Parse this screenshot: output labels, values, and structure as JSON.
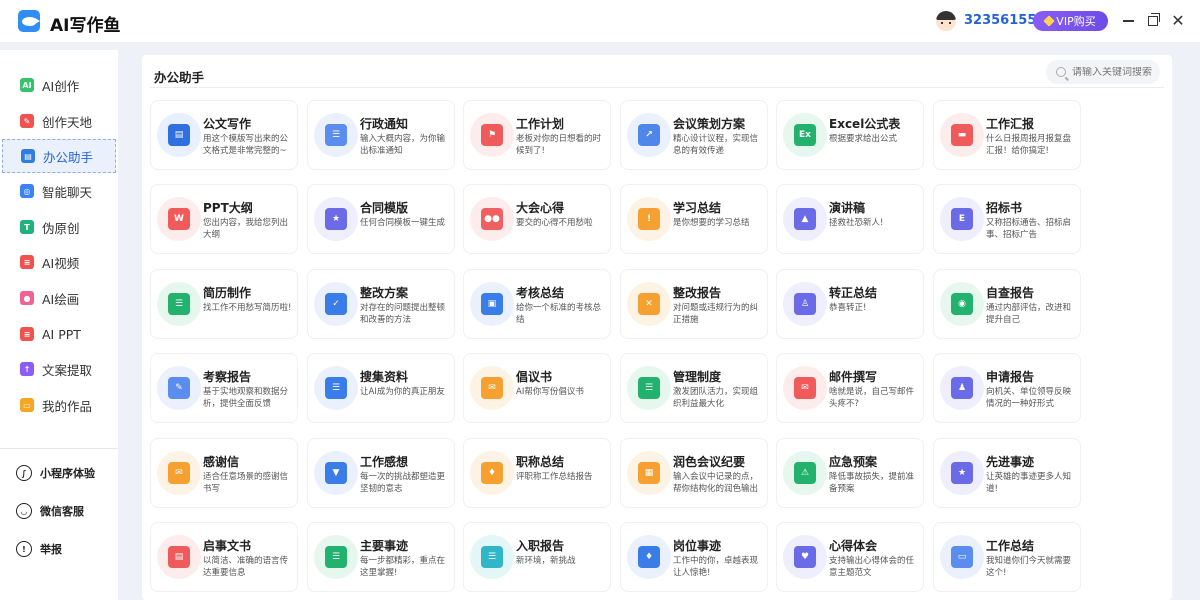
{
  "app": {
    "title": "AI写作鱼"
  },
  "header": {
    "user_id": "32356155",
    "vip_label": "VIP购买"
  },
  "sidebar": {
    "items": [
      {
        "label": "AI创作",
        "color": "#34c26a",
        "glyph": "AI"
      },
      {
        "label": "创作天地",
        "color": "#ef5350",
        "glyph": "✎"
      },
      {
        "label": "办公助手",
        "color": "#2f7de1",
        "glyph": "▤",
        "active": true
      },
      {
        "label": "智能聊天",
        "color": "#3b82f6",
        "glyph": "◎"
      },
      {
        "label": "伪原创",
        "color": "#22b07d",
        "glyph": "T"
      },
      {
        "label": "AI视频",
        "color": "#ef5350",
        "glyph": "≡"
      },
      {
        "label": "AI绘画",
        "color": "#f06292",
        "glyph": "●"
      },
      {
        "label": "AI PPT",
        "color": "#ef5350",
        "glyph": "≡"
      },
      {
        "label": "文案提取",
        "color": "#8b5cf6",
        "glyph": "↑"
      },
      {
        "label": "我的作品",
        "color": "#f5a623",
        "glyph": "▭"
      }
    ],
    "extras": [
      {
        "label": "小程序体验",
        "glyph": "∫"
      },
      {
        "label": "微信客服",
        "glyph": "◡"
      },
      {
        "label": "举报",
        "glyph": "!"
      }
    ]
  },
  "main": {
    "title": "办公助手",
    "search_placeholder": "请输入关键词搜索",
    "cards": [
      {
        "name": "公文写作",
        "desc": "用这个模版写出来的公文格式是非常完整的~",
        "color": "#2f6fe0",
        "bg": "#e9f0fd",
        "glyph": "▤"
      },
      {
        "name": "行政通知",
        "desc": "输入大概内容，为你输出标准通知",
        "color": "#5b8def",
        "bg": "#eaf1fd",
        "glyph": "☰"
      },
      {
        "name": "工作计划",
        "desc": "老板对你的日想看的时候到了!",
        "color": "#ef5a5a",
        "bg": "#fdecec",
        "glyph": "⚑"
      },
      {
        "name": "会议策划方案",
        "desc": "精心设计议程，实现信息的有效传递",
        "color": "#4f86ea",
        "bg": "#eaf1fd",
        "glyph": "↗"
      },
      {
        "name": "Excel公式表",
        "desc": "根据要求给出公式",
        "color": "#23b26d",
        "bg": "#e6f7ee",
        "glyph": "Ex"
      },
      {
        "name": "工作汇报",
        "desc": "什么日报周报月报复盘汇报！给你搞定!",
        "color": "#f05a5a",
        "bg": "#fdecec",
        "glyph": "▬"
      },
      {
        "name": "PPT大纲",
        "desc": "您出内容，我给您列出大纲",
        "color": "#f05a5a",
        "bg": "#fdecec",
        "glyph": "W"
      },
      {
        "name": "合同模版",
        "desc": "任何合同模板一键生成",
        "color": "#6b6be8",
        "bg": "#eeeefc",
        "glyph": "★"
      },
      {
        "name": "大会心得",
        "desc": "要交的心得不用愁啦",
        "color": "#f06060",
        "bg": "#fdecec",
        "glyph": "●●"
      },
      {
        "name": "学习总结",
        "desc": "是你想要的学习总结",
        "color": "#f5a030",
        "bg": "#fdf3e4",
        "glyph": "!"
      },
      {
        "name": "演讲稿",
        "desc": "拯救社恐新人!",
        "color": "#6b6be8",
        "bg": "#eeeefc",
        "glyph": "▲"
      },
      {
        "name": "招标书",
        "desc": "又称招标通告、招标启事、招标广告",
        "color": "#6b6be8",
        "bg": "#eeeefc",
        "glyph": "E"
      },
      {
        "name": "简历制作",
        "desc": "找工作不用愁写简历啦!",
        "color": "#23b26d",
        "bg": "#e6f7ee",
        "glyph": "☰"
      },
      {
        "name": "整改方案",
        "desc": "对存在的问题提出整顿和改善的方法",
        "color": "#3b7de8",
        "bg": "#eaf1fd",
        "glyph": "✓"
      },
      {
        "name": "考核总结",
        "desc": "给你一个标准的考核总结",
        "color": "#3b7de8",
        "bg": "#eaf1fd",
        "glyph": "▣"
      },
      {
        "name": "整改报告",
        "desc": "对问题或违规行为的纠正措施",
        "color": "#f5a030",
        "bg": "#fdf3e4",
        "glyph": "✕"
      },
      {
        "name": "转正总结",
        "desc": "恭喜转正!",
        "color": "#6b6be8",
        "bg": "#eeeefc",
        "glyph": "♙"
      },
      {
        "name": "自查报告",
        "desc": "通过内部评估，改进和提升自己",
        "color": "#23b26d",
        "bg": "#e6f7ee",
        "glyph": "◉"
      },
      {
        "name": "考察报告",
        "desc": "基于实地观察和数据分析，提供全面反馈",
        "color": "#5b8def",
        "bg": "#eaf1fd",
        "glyph": "✎"
      },
      {
        "name": "搜集资料",
        "desc": "让AI成为你的真正朋友",
        "color": "#3b7de8",
        "bg": "#eaf1fd",
        "glyph": "☰"
      },
      {
        "name": "倡议书",
        "desc": "AI帮你写份倡议书",
        "color": "#f5a030",
        "bg": "#fdf3e4",
        "glyph": "✉"
      },
      {
        "name": "管理制度",
        "desc": "激发团队活力，实现组织利益最大化",
        "color": "#23b26d",
        "bg": "#e6f7ee",
        "glyph": "☰"
      },
      {
        "name": "邮件撰写",
        "desc": "啥就是说，自己写邮件头疼不?",
        "color": "#f05a5a",
        "bg": "#fdecec",
        "glyph": "✉"
      },
      {
        "name": "申请报告",
        "desc": "向机关、单位领导反映情况的一种好形式",
        "color": "#6b6be8",
        "bg": "#eeeefc",
        "glyph": "♟"
      },
      {
        "name": "感谢信",
        "desc": "适合任意场景的感谢信书写",
        "color": "#f5a030",
        "bg": "#fdf3e4",
        "glyph": "✉"
      },
      {
        "name": "工作感想",
        "desc": "每一次的挑战都塑造更坚韧的意志",
        "color": "#3b7de8",
        "bg": "#eaf1fd",
        "glyph": "▼"
      },
      {
        "name": "职称总结",
        "desc": "评职称工作总结报告",
        "color": "#f5a030",
        "bg": "#fdf3e4",
        "glyph": "♦"
      },
      {
        "name": "润色会议纪要",
        "desc": "输入会议中记录的点，帮你结构化的润色输出",
        "color": "#f5a030",
        "bg": "#fdf3e4",
        "glyph": "▦"
      },
      {
        "name": "应急预案",
        "desc": "降低事故损失，提前准备预案",
        "color": "#23b26d",
        "bg": "#e6f7ee",
        "glyph": "⚠"
      },
      {
        "name": "先进事迹",
        "desc": "让英雄的事迹更多人知道!",
        "color": "#6b6be8",
        "bg": "#eeeefc",
        "glyph": "★"
      },
      {
        "name": "启事文书",
        "desc": "以简洁、准确的语言传达重要信息",
        "color": "#f05a5a",
        "bg": "#fdecec",
        "glyph": "▤"
      },
      {
        "name": "主要事迹",
        "desc": "每一步都精彩，重点在这里掌握!",
        "color": "#23b26d",
        "bg": "#e6f7ee",
        "glyph": "☰"
      },
      {
        "name": "入职报告",
        "desc": "新环境，新挑战",
        "color": "#2fb6c9",
        "bg": "#e4f6f8",
        "glyph": "☰"
      },
      {
        "name": "岗位事迹",
        "desc": "工作中的你，卓越表现让人惊艳!",
        "color": "#3b7de8",
        "bg": "#eaf1fd",
        "glyph": "♦"
      },
      {
        "name": "心得体会",
        "desc": "支持输出心得体会的任意主题范文",
        "color": "#6b6be8",
        "bg": "#eeeefc",
        "glyph": "♥"
      },
      {
        "name": "工作总结",
        "desc": "我知道你们今天就需要这个!",
        "color": "#5b8def",
        "bg": "#eaf1fd",
        "glyph": "▭"
      }
    ]
  }
}
